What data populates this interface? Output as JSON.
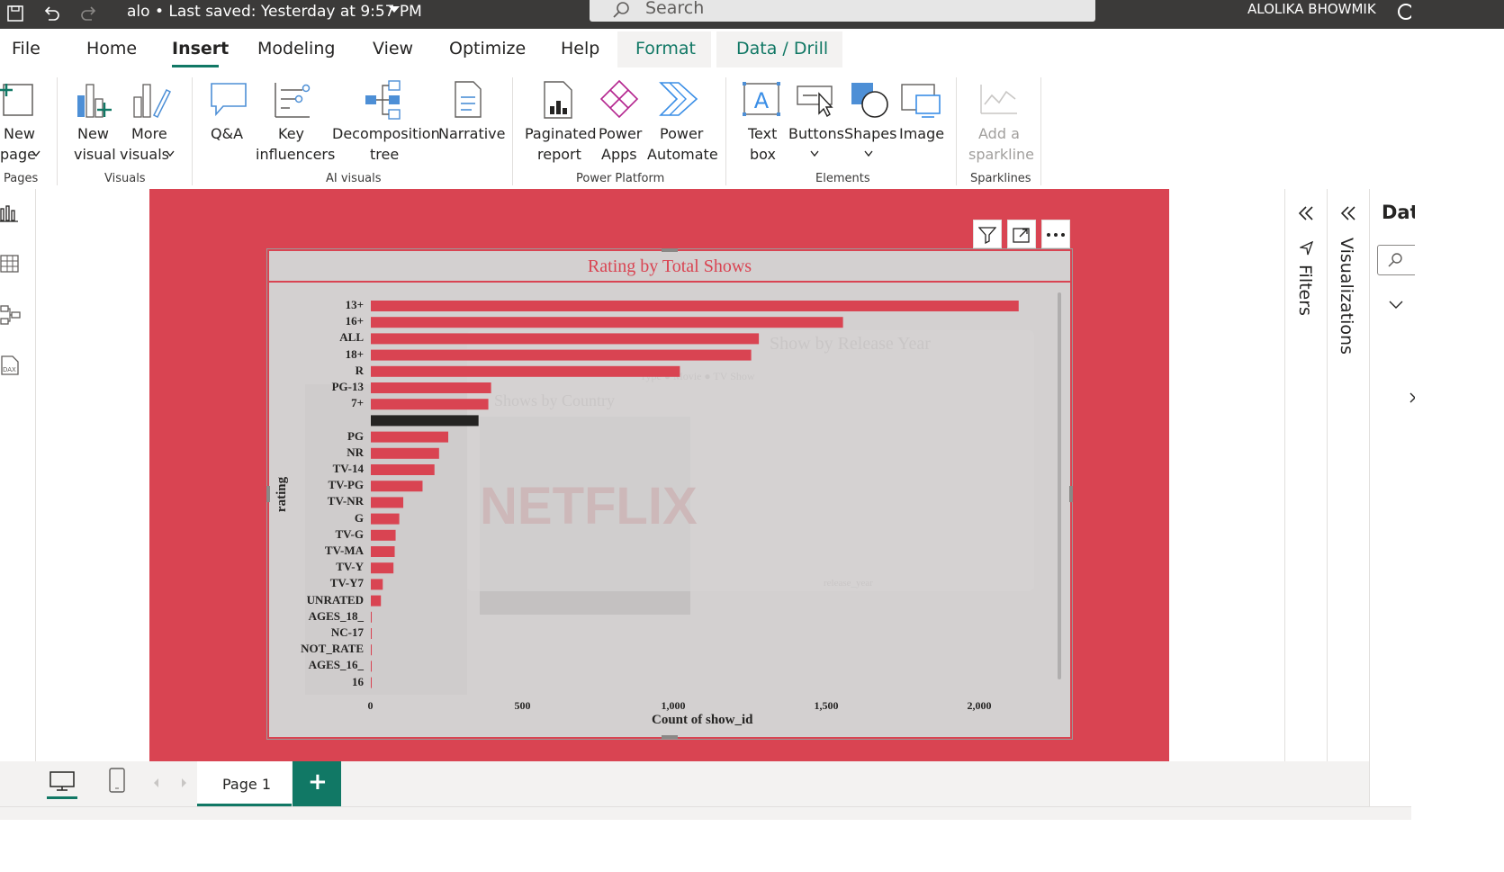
{
  "titlebar": {
    "doc_title": "alo • Last saved: Yesterday at 9:57 PM",
    "search_placeholder": "Search",
    "user": "ALOLIKA BHOWMIK"
  },
  "menu": [
    "File",
    "Home",
    "Insert",
    "Modeling",
    "View",
    "Optimize",
    "Help",
    "Format",
    "Data / Drill"
  ],
  "active_menu": "Insert",
  "ribbon": {
    "pages": {
      "new_page_1": "New",
      "new_page_2": "page",
      "group": "Pages"
    },
    "visuals": {
      "new_visual_1": "New",
      "new_visual_2": "visual",
      "more_visuals_1": "More",
      "more_visuals_2": "visuals",
      "group": "Visuals"
    },
    "ai": {
      "qa": "Q&A",
      "key_1": "Key",
      "key_2": "influencers",
      "decomp_1": "Decomposition",
      "decomp_2": "tree",
      "narrative": "Narrative",
      "group": "AI visuals"
    },
    "power": {
      "paginated_1": "Paginated",
      "paginated_2": "report",
      "apps_1": "Power",
      "apps_2": "Apps",
      "automate_1": "Power",
      "automate_2": "Automate",
      "group": "Power Platform"
    },
    "elements": {
      "textbox_1": "Text",
      "textbox_2": "box",
      "buttons": "Buttons",
      "shapes": "Shapes",
      "image": "Image",
      "group": "Elements"
    },
    "sparklines": {
      "add_1": "Add a",
      "add_2": "sparkline",
      "group": "Sparklines"
    }
  },
  "panes": {
    "filters": "Filters",
    "visualizations": "Visualizations",
    "data": "Dat"
  },
  "tabs": {
    "page1": "Page 1",
    "add": "+"
  },
  "colors": {
    "accent": "#117865",
    "bar": "#d94452",
    "highlight": "#252423",
    "visual_bg": "#d3d0d0"
  },
  "chart_data": {
    "type": "bar",
    "orientation": "horizontal",
    "title": "Rating by Total Shows",
    "xlabel": "Count of show_id",
    "ylabel": "rating",
    "xlim": [
      0,
      2200
    ],
    "xticks": [
      "0",
      "500",
      "1,000",
      "1,500",
      "2,000"
    ],
    "categories": [
      "13+",
      "16+",
      "ALL",
      "18+",
      "R",
      "PG-13",
      "7+",
      "",
      "PG",
      "NR",
      "TV-14",
      "TV-PG",
      "TV-NR",
      "G",
      "TV-G",
      "TV-MA",
      "TV-Y",
      "TV-Y7",
      "UNRATED",
      "AGES_18_",
      "NC-17",
      "NOT_RATE",
      "AGES_16_",
      "16"
    ],
    "values": [
      2117,
      1543,
      1268,
      1243,
      1010,
      393,
      384,
      352,
      253,
      223,
      208,
      169,
      106,
      93,
      81,
      78,
      74,
      39,
      33,
      3,
      3,
      3,
      2,
      1
    ],
    "highlighted_index": 7,
    "background_visual_texts": [
      "Show by Release Year",
      "Type ● Movie ● TV Show",
      "Shows by Country",
      "NETFLIX",
      "release_year"
    ]
  }
}
